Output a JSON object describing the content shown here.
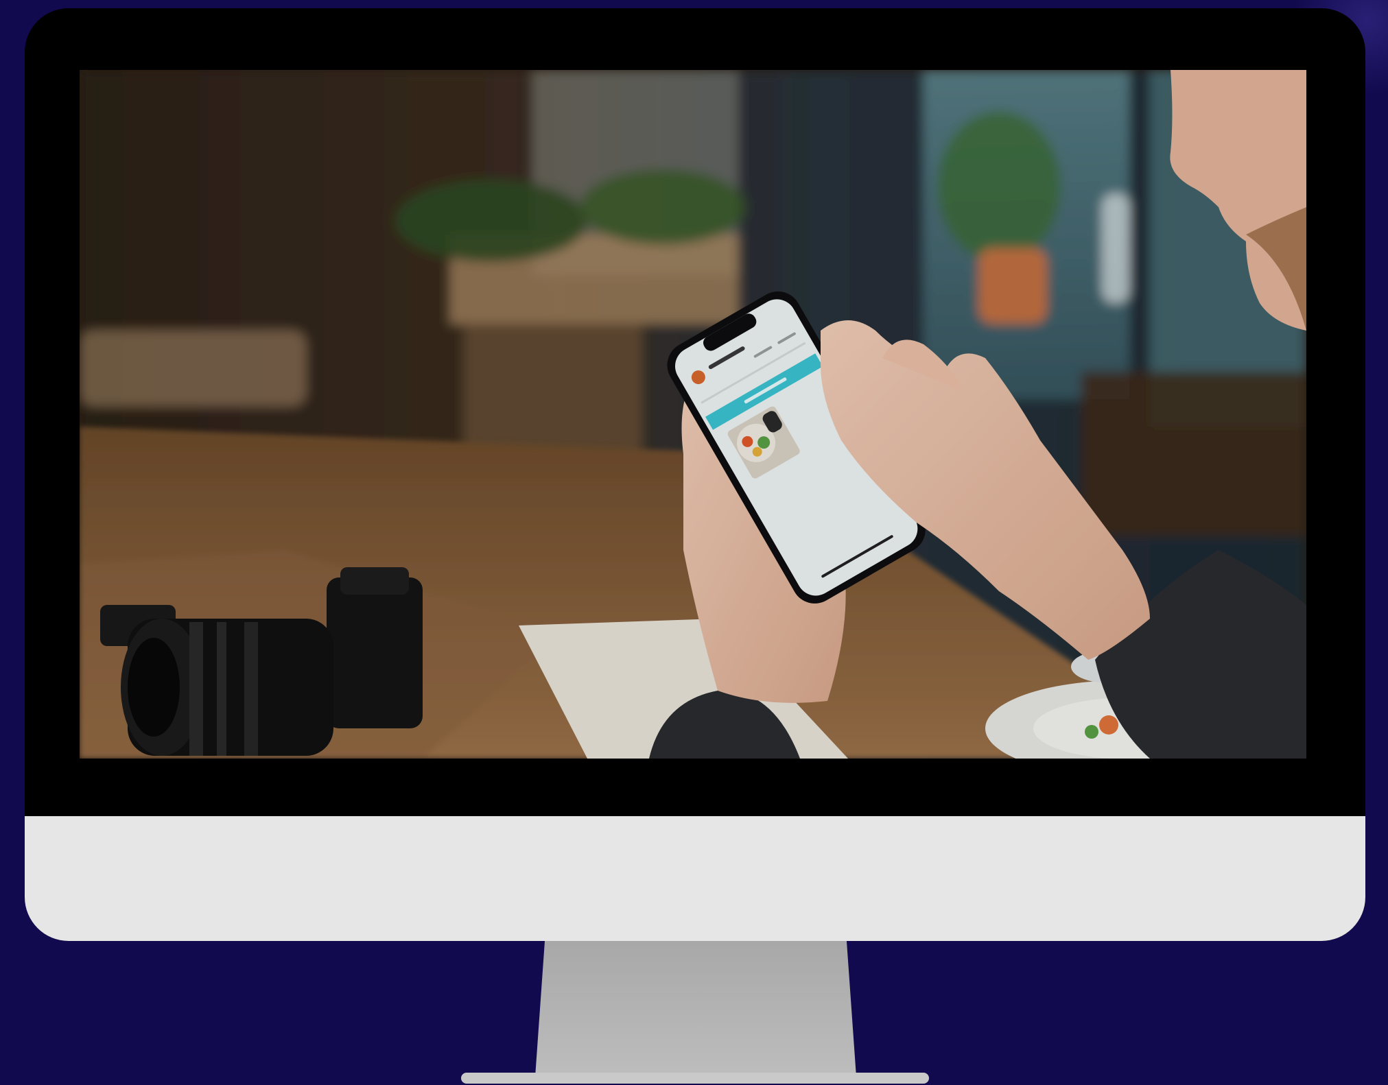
{
  "scene": {
    "colors": {
      "background": "#120a4e",
      "bezel": "#000000",
      "chin": "#e6e6e6",
      "stand": "#b4b4b4",
      "app_accent": "#3cc4d2"
    },
    "icons": [
      "monitor-icon",
      "smartphone-icon",
      "camera-icon"
    ]
  }
}
